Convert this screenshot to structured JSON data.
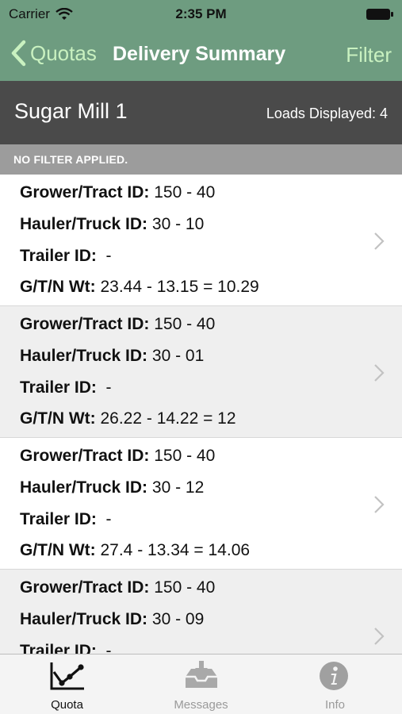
{
  "status_bar": {
    "carrier": "Carrier",
    "time": "2:35 PM"
  },
  "nav": {
    "back_label": "Quotas",
    "title": "Delivery Summary",
    "filter_label": "Filter"
  },
  "summary": {
    "mill_name": "Sugar Mill 1",
    "loads_text": "Loads Displayed: 4"
  },
  "filter_status": "NO FILTER APPLIED.",
  "labels": {
    "grower": "Grower/Tract ID:",
    "hauler": "Hauler/Truck ID:",
    "trailer": "Trailer ID:",
    "weight": "G/T/N Wt:"
  },
  "loads": [
    {
      "grower": "150 - 40",
      "hauler": "30 - 10",
      "trailer": "-",
      "weight": "23.44 - 13.15 = 10.29"
    },
    {
      "grower": "150 - 40",
      "hauler": "30 - 01",
      "trailer": "-",
      "weight": "26.22 - 14.22 = 12"
    },
    {
      "grower": "150 - 40",
      "hauler": "30 - 12",
      "trailer": "-",
      "weight": "27.4 - 13.34 = 14.06"
    },
    {
      "grower": "150 - 40",
      "hauler": "30 - 09",
      "trailer": "-",
      "weight": ""
    }
  ],
  "tabs": [
    {
      "label": "Quota",
      "icon": "chart-icon",
      "active": true
    },
    {
      "label": "Messages",
      "icon": "inbox-icon",
      "active": false
    },
    {
      "label": "Info",
      "icon": "info-icon",
      "active": false
    }
  ],
  "colors": {
    "nav_bg": "#6e9c80",
    "nav_accent": "#c9f1c0",
    "mill_bar": "#4a4a4a",
    "filter_strip": "#9c9c9c"
  }
}
